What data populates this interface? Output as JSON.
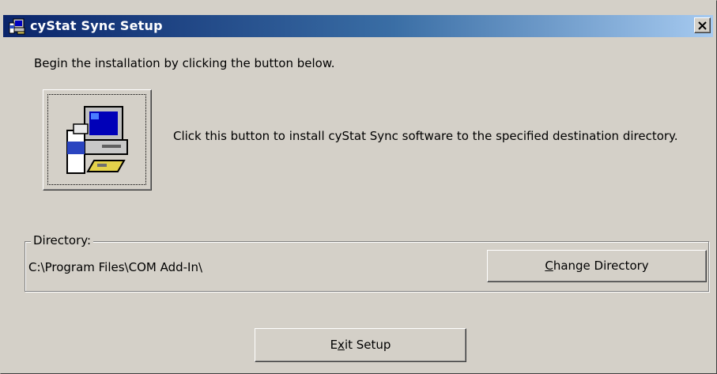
{
  "window": {
    "title": "cyStat Sync Setup"
  },
  "header": {
    "instruction": "Begin the installation by clicking the button below."
  },
  "install": {
    "description": "Click this button to install cyStat Sync software to the specified destination directory."
  },
  "directory": {
    "label": "Directory:",
    "path": "C:\\Program Files\\COM Add-In\\",
    "change_button": {
      "pre": "",
      "accel": "C",
      "post": "hange Directory"
    }
  },
  "footer": {
    "exit_button": {
      "pre": "E",
      "accel": "x",
      "post": "it Setup"
    }
  },
  "colors": {
    "face": "#d4d0c8",
    "title_start": "#0a246a",
    "title_end": "#a6caf0"
  },
  "icons": {
    "app": "installer-computer-icon",
    "close": "close-x-icon",
    "install": "computer-setup-icon"
  }
}
